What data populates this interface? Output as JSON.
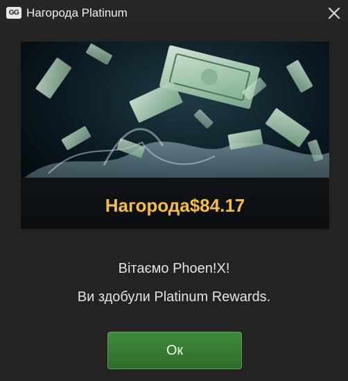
{
  "window": {
    "logo_text": "GG",
    "title": "Нагорода Platinum",
    "close_icon": "close-icon"
  },
  "banner": {
    "reward_text": "Нагорода$84.17",
    "reward_color": "#f7bf37"
  },
  "message": {
    "line1": "Вітаємо Phoen!X!",
    "line2": "Ви здобули Platinum Rewards."
  },
  "actions": {
    "ok_label": "Ок",
    "ok_color": "#3f8a3c"
  }
}
